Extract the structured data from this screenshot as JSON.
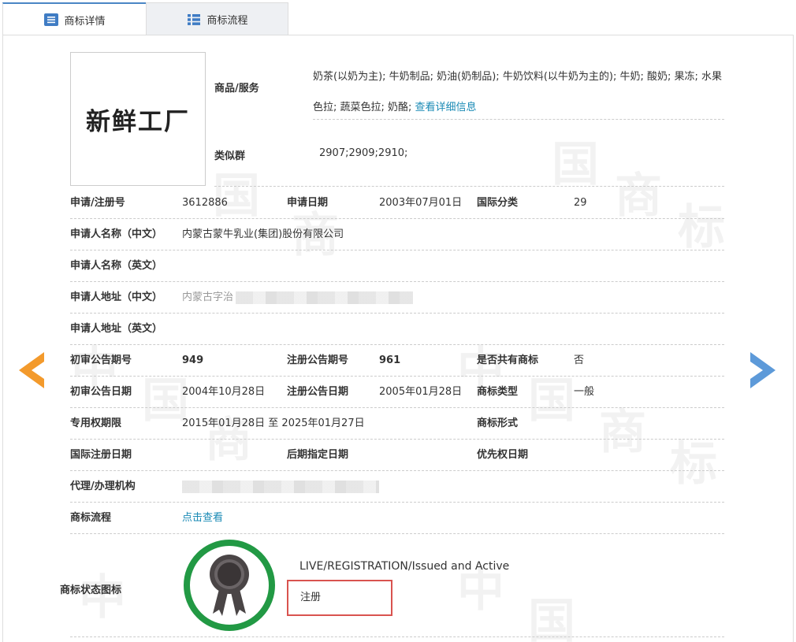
{
  "tabs": [
    {
      "label": "商标详情",
      "icon": "list-document-icon",
      "active": true
    },
    {
      "label": "商标流程",
      "icon": "grid-list-icon",
      "active": false
    }
  ],
  "logo": {
    "text": "新鲜工厂"
  },
  "goods": {
    "label": "商品/服务",
    "text": "奶茶(以奶为主); 牛奶制品; 奶油(奶制品); 牛奶饮料(以牛奶为主的); 牛奶; 酸奶; 果冻; 水果色拉; 蔬菜色拉; 奶酪;",
    "link": "查看详细信息"
  },
  "similar_group": {
    "label": "类似群",
    "value": "2907;2909;2910;"
  },
  "fields": {
    "reg_no": {
      "label": "申请/注册号",
      "value": "3612886"
    },
    "apply_date": {
      "label": "申请日期",
      "value": "2003年07月01日"
    },
    "intl_class": {
      "label": "国际分类",
      "value": "29"
    },
    "applicant_cn": {
      "label": "申请人名称（中文）",
      "value": "内蒙古蒙牛乳业(集团)股份有限公司"
    },
    "applicant_en": {
      "label": "申请人名称（英文）",
      "value": ""
    },
    "address_cn": {
      "label": "申请人地址（中文）",
      "value": "内蒙古字治"
    },
    "address_en": {
      "label": "申请人地址（英文）",
      "value": ""
    },
    "prelim_no": {
      "label": "初审公告期号",
      "value": "949"
    },
    "reg_pub_no": {
      "label": "注册公告期号",
      "value": "961"
    },
    "shared": {
      "label": "是否共有商标",
      "value": "否"
    },
    "prelim_date": {
      "label": "初审公告日期",
      "value": "2004年10月28日"
    },
    "reg_pub_date": {
      "label": "注册公告日期",
      "value": "2005年01月28日"
    },
    "tm_type": {
      "label": "商标类型",
      "value": "一般"
    },
    "exclusive": {
      "label": "专用权期限",
      "value": "2015年01月28日 至 2025年01月27日"
    },
    "tm_form": {
      "label": "商标形式",
      "value": ""
    },
    "intl_reg_date": {
      "label": "国际注册日期",
      "value": ""
    },
    "later_date": {
      "label": "后期指定日期",
      "value": ""
    },
    "priority_date": {
      "label": "优先权日期",
      "value": ""
    },
    "agent": {
      "label": "代理/办理机构",
      "value": ""
    },
    "flow": {
      "label": "商标流程",
      "link": "点击查看"
    }
  },
  "status": {
    "label": "商标状态图标",
    "icon": "rosette-seal-icon",
    "english": "LIVE/REGISTRATION/Issued and Active",
    "chinese": "注册"
  },
  "nav": {
    "prev_icon": "arrow-left-icon",
    "next_icon": "arrow-right-icon"
  },
  "colors": {
    "accent": "#1a8ab5",
    "prev_arrow": "#f39a2c",
    "next_arrow": "#5d9ad9",
    "seal_ring": "#229944",
    "highlight_box": "#d9534f"
  }
}
